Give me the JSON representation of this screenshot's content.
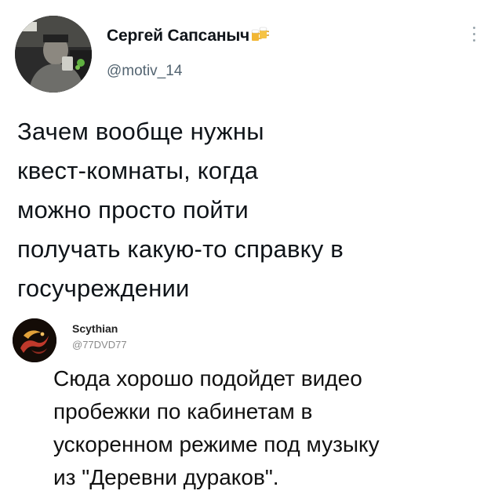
{
  "tweet": {
    "author_name": "Сергей Сапсаныч",
    "author_handle": "@motiv_14",
    "text_lines": [
      "Зачем вообще нужны",
      "квест-комнаты, когда",
      "можно просто пойти",
      "получать какую-то справку в",
      "госучреждении"
    ],
    "icons": {
      "name_badge": "beer-mugs-icon",
      "menu": "more-vertical-icon"
    }
  },
  "reply": {
    "author_name": "Scythian",
    "author_handle": "@77DVD77",
    "text_lines": [
      "Сюда хорошо подойдет видео",
      "пробежки по кабинетам в",
      "ускоренном режиме под музыку",
      "из \"Деревни дураков\"."
    ]
  },
  "colors": {
    "text": "#0f1419",
    "secondary": "#536471",
    "reply_avatar_accent": "#c0392b"
  }
}
